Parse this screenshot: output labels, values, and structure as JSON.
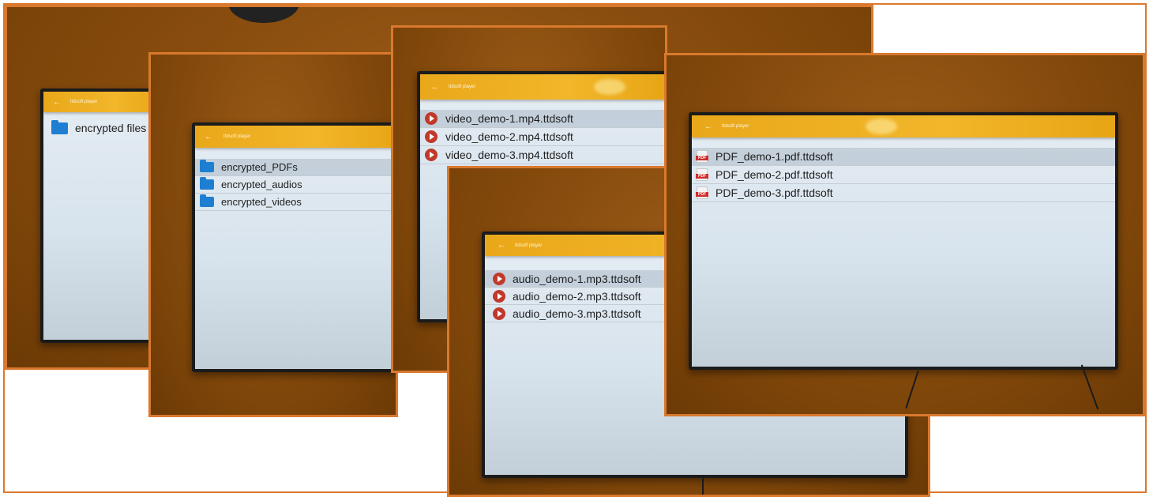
{
  "app_title": "ttdsoft player",
  "screens": {
    "root": {
      "items": [
        {
          "label": "encrypted files",
          "icon": "folder-icon"
        }
      ]
    },
    "folders": {
      "items": [
        {
          "label": "encrypted_PDFs",
          "icon": "folder-icon"
        },
        {
          "label": "encrypted_audios",
          "icon": "folder-icon"
        },
        {
          "label": "encrypted_videos",
          "icon": "folder-icon"
        }
      ]
    },
    "videos": {
      "items": [
        {
          "label": "video_demo-1.mp4.ttdsoft",
          "icon": "play-icon"
        },
        {
          "label": "video_demo-2.mp4.ttdsoft",
          "icon": "play-icon"
        },
        {
          "label": "video_demo-3.mp4.ttdsoft",
          "icon": "play-icon"
        }
      ]
    },
    "audios": {
      "items": [
        {
          "label": "audio_demo-1.mp3.ttdsoft",
          "icon": "play-icon"
        },
        {
          "label": "audio_demo-2.mp3.ttdsoft",
          "icon": "play-icon"
        },
        {
          "label": "audio_demo-3.mp3.ttdsoft",
          "icon": "play-icon"
        }
      ]
    },
    "pdfs": {
      "items": [
        {
          "label": "PDF_demo-1.pdf.ttdsoft",
          "icon": "pdf-icon"
        },
        {
          "label": "PDF_demo-2.pdf.ttdsoft",
          "icon": "pdf-icon"
        },
        {
          "label": "PDF_demo-3.pdf.ttdsoft",
          "icon": "pdf-icon"
        }
      ],
      "pdf_badge": "PDF"
    }
  },
  "colors": {
    "appbar": "#f2b62a",
    "panel_border": "#d9792e",
    "wall": "#8a4f10",
    "folder": "#1e7fd2",
    "play": "#c0392b",
    "pdf_badge": "#d02c2c"
  }
}
